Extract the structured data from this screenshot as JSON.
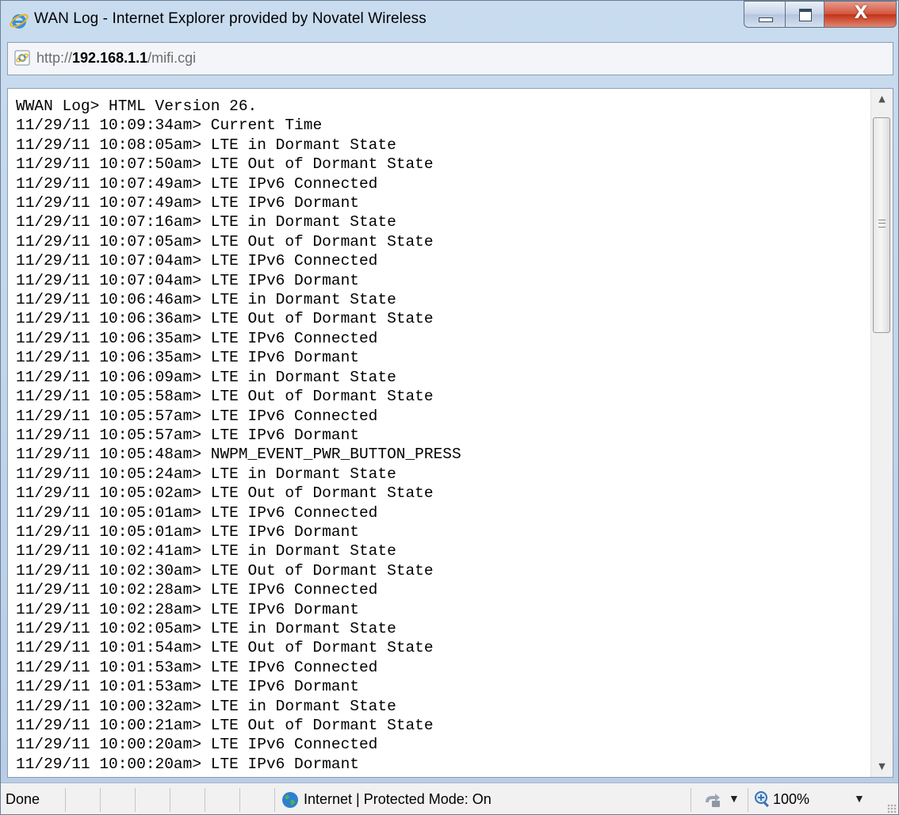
{
  "window": {
    "title": "WAN Log - Internet Explorer provided by Novatel Wireless",
    "close_glyph": "X"
  },
  "address": {
    "prefix": "http://",
    "host": "192.168.1.1",
    "path": "/mifi.cgi"
  },
  "log": {
    "lines": [
      "WWAN Log> HTML Version 26.",
      "11/29/11 10:09:34am> Current Time",
      "11/29/11 10:08:05am> LTE in Dormant State",
      "11/29/11 10:07:50am> LTE Out of Dormant State",
      "11/29/11 10:07:49am> LTE IPv6 Connected",
      "11/29/11 10:07:49am> LTE IPv6 Dormant",
      "11/29/11 10:07:16am> LTE in Dormant State",
      "11/29/11 10:07:05am> LTE Out of Dormant State",
      "11/29/11 10:07:04am> LTE IPv6 Connected",
      "11/29/11 10:07:04am> LTE IPv6 Dormant",
      "11/29/11 10:06:46am> LTE in Dormant State",
      "11/29/11 10:06:36am> LTE Out of Dormant State",
      "11/29/11 10:06:35am> LTE IPv6 Connected",
      "11/29/11 10:06:35am> LTE IPv6 Dormant",
      "11/29/11 10:06:09am> LTE in Dormant State",
      "11/29/11 10:05:58am> LTE Out of Dormant State",
      "11/29/11 10:05:57am> LTE IPv6 Connected",
      "11/29/11 10:05:57am> LTE IPv6 Dormant",
      "11/29/11 10:05:48am> NWPM_EVENT_PWR_BUTTON_PRESS",
      "11/29/11 10:05:24am> LTE in Dormant State",
      "11/29/11 10:05:02am> LTE Out of Dormant State",
      "11/29/11 10:05:01am> LTE IPv6 Connected",
      "11/29/11 10:05:01am> LTE IPv6 Dormant",
      "11/29/11 10:02:41am> LTE in Dormant State",
      "11/29/11 10:02:30am> LTE Out of Dormant State",
      "11/29/11 10:02:28am> LTE IPv6 Connected",
      "11/29/11 10:02:28am> LTE IPv6 Dormant",
      "11/29/11 10:02:05am> LTE in Dormant State",
      "11/29/11 10:01:54am> LTE Out of Dormant State",
      "11/29/11 10:01:53am> LTE IPv6 Connected",
      "11/29/11 10:01:53am> LTE IPv6 Dormant",
      "11/29/11 10:00:32am> LTE in Dormant State",
      "11/29/11 10:00:21am> LTE Out of Dormant State",
      "11/29/11 10:00:20am> LTE IPv6 Connected",
      "11/29/11 10:00:20am> LTE IPv6 Dormant"
    ]
  },
  "status": {
    "text": "Done",
    "zone": "Internet | Protected Mode: On",
    "zoom": "100%"
  },
  "colors": {
    "titlebar": "#c9dcef",
    "close_button": "#c43117",
    "border": "#6b7f95"
  }
}
